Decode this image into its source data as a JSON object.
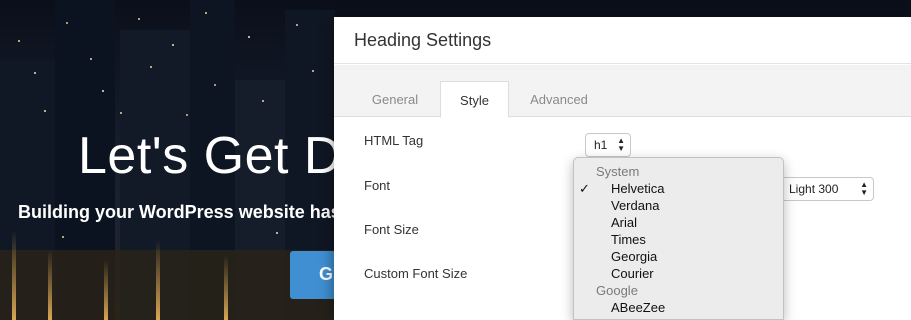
{
  "hero": {
    "title": "Let's Get Do",
    "subtitle": "Building your WordPress website has",
    "button_label": "G"
  },
  "modal": {
    "title": "Heading Settings",
    "tabs": [
      {
        "label": "General",
        "active": false
      },
      {
        "label": "Style",
        "active": true
      },
      {
        "label": "Advanced",
        "active": false
      }
    ],
    "fields": {
      "html_tag": {
        "label": "HTML Tag",
        "value": "h1"
      },
      "font": {
        "label": "Font",
        "weight_value": "Light 300"
      },
      "font_size": {
        "label": "Font Size"
      },
      "custom_font_size": {
        "label": "Custom Font Size"
      }
    }
  },
  "font_dropdown": {
    "groups": [
      {
        "label": "System",
        "options": [
          "Helvetica",
          "Verdana",
          "Arial",
          "Times",
          "Georgia",
          "Courier"
        ]
      },
      {
        "label": "Google",
        "options": [
          "ABeeZee"
        ]
      }
    ],
    "selected": "Helvetica",
    "check_icon": "checkmark-icon"
  },
  "colors": {
    "accent_button": "#3f8fd2",
    "modal_bg": "#ffffff",
    "tabs_bg": "#f3f3f3",
    "dropdown_bg": "#ececec"
  }
}
